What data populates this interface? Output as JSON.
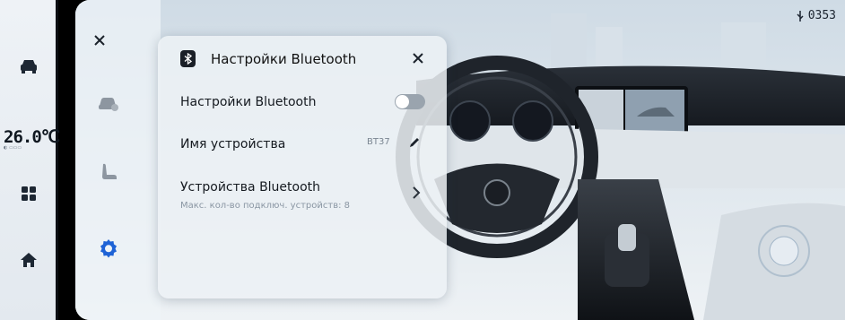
{
  "status": {
    "time": "0353"
  },
  "dock": {
    "temperature": "26.0℃",
    "temperature_sub": "◐ ▭▭▭"
  },
  "dialog": {
    "title": "Настройки Bluetooth",
    "bluetooth_toggle_label": "Настройки Bluetooth",
    "bluetooth_enabled": false,
    "device_name_label": "Имя устройства",
    "device_name_value": "BT37",
    "devices_label": "Устройства Bluetooth",
    "devices_sub": "Макс. кол-во подключ. устройств: 8"
  },
  "icons": {
    "dock": [
      "car-icon",
      "apps-grid-icon",
      "home-icon"
    ],
    "categories": [
      "car-settings-icon",
      "seat-icon",
      "gear-icon"
    ],
    "dialog": [
      "bluetooth-icon",
      "close-icon",
      "edit-pencil-icon",
      "chevron-right-icon"
    ]
  },
  "colors": {
    "accent": "#1e63d6",
    "dark": "#1a1f27"
  }
}
